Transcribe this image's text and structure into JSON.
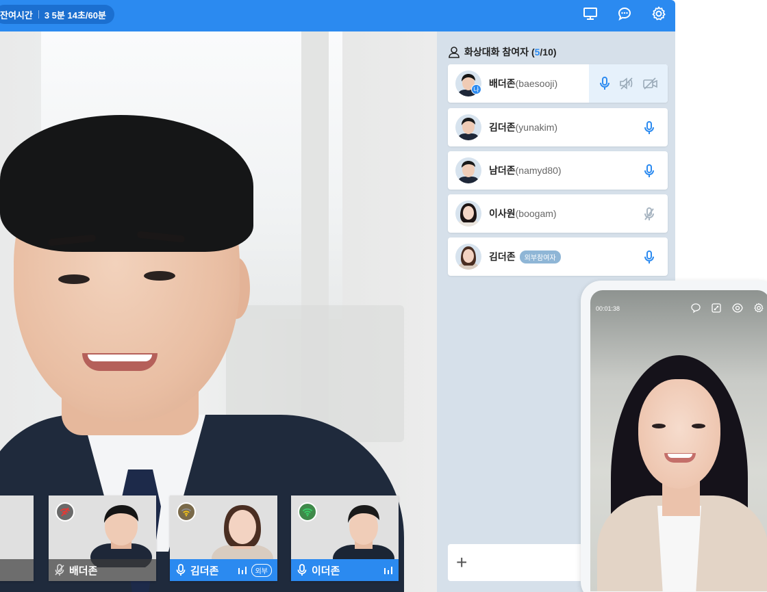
{
  "topbar": {
    "timer_label": "잔여시간",
    "timer_value": "3 5분 14초/60분",
    "icons": [
      "monitor-icon",
      "chat-icon",
      "settings-icon"
    ]
  },
  "panel": {
    "title": "화상대화 참여자 (",
    "count_current": "5",
    "count_total": "/10)",
    "participants": [
      {
        "name": "배더존",
        "id": "(baesooji)",
        "badge": "나",
        "is_me": true
      },
      {
        "name": "김더존",
        "id": "(yunakim)"
      },
      {
        "name": "남더존",
        "id": "(namyd80)"
      },
      {
        "name": "이사원",
        "id": "(boogam)",
        "mic_muted": true
      },
      {
        "name": "김더존",
        "id": "",
        "external_tag": "외부참여자"
      }
    ]
  },
  "thumbnails": [
    {
      "name": "배더존",
      "network": "weak",
      "mic": "muted"
    },
    {
      "name": "김더존",
      "network": "medium",
      "mic": "on",
      "tag": "외부"
    },
    {
      "name": "이더존",
      "network": "good",
      "mic": "on"
    }
  ],
  "chat": {
    "add_symbol": "+"
  },
  "phone": {
    "timer": "00:01:38"
  },
  "colors": {
    "accent": "#2b8af0",
    "panel_bg": "#d6e0ea"
  }
}
